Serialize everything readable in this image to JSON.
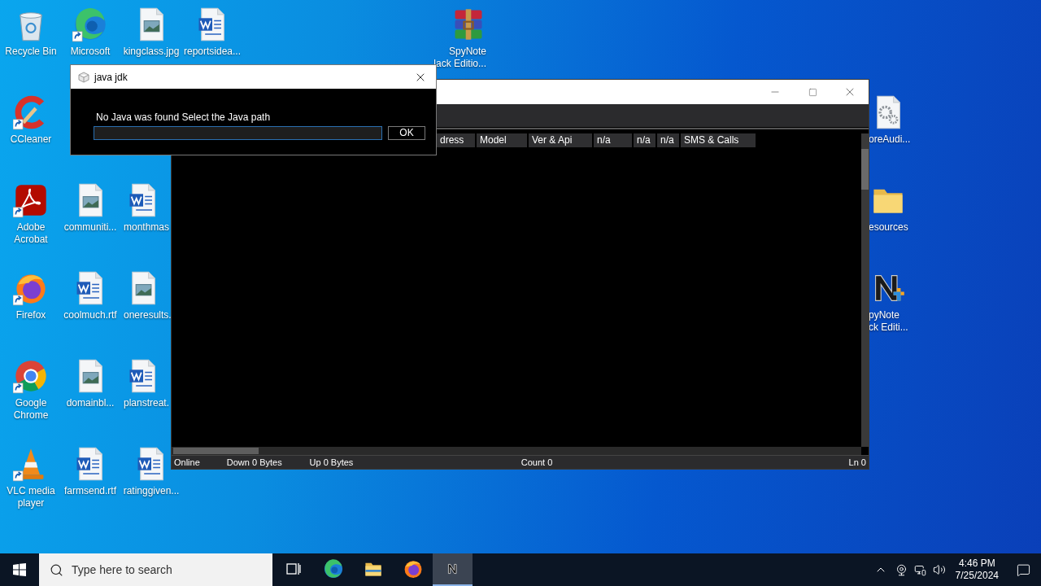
{
  "desktop_icons": [
    {
      "kind": "recycle_bin",
      "lines": [
        "Recycle Bin"
      ],
      "shortcut": false
    },
    {
      "kind": "edge",
      "lines": [
        "Microsoft"
      ],
      "shortcut": true
    },
    {
      "kind": "image_file",
      "lines": [
        "kingclass.jpg"
      ],
      "shortcut": false
    },
    {
      "kind": "word_file",
      "lines": [
        "reportsidea..."
      ],
      "shortcut": false
    },
    {
      "kind": "winrar",
      "lines": [
        "SpyNote",
        "lack Editio..."
      ],
      "shortcut": false
    },
    {
      "kind": "ccleaner",
      "lines": [
        "CCleaner"
      ],
      "shortcut": true
    },
    {
      "kind": "settings_file",
      "lines": [
        "oreAudi..."
      ],
      "shortcut": false
    },
    {
      "kind": "acrobat",
      "lines": [
        "Adobe",
        "Acrobat"
      ],
      "shortcut": true
    },
    {
      "kind": "image_file",
      "lines": [
        "communiti..."
      ],
      "shortcut": false
    },
    {
      "kind": "word_file",
      "lines": [
        "monthmas"
      ],
      "shortcut": false
    },
    {
      "kind": "folder",
      "lines": [
        "esources"
      ],
      "shortcut": false
    },
    {
      "kind": "firefox",
      "lines": [
        "Firefox"
      ],
      "shortcut": true
    },
    {
      "kind": "word_file",
      "lines": [
        "coolmuch.rtf"
      ],
      "shortcut": false
    },
    {
      "kind": "image_file",
      "lines": [
        "oneresults."
      ],
      "shortcut": false
    },
    {
      "kind": "spynote",
      "lines": [
        "pyNote",
        "ck Editi..."
      ],
      "shortcut": false
    },
    {
      "kind": "chrome",
      "lines": [
        "Google",
        "Chrome"
      ],
      "shortcut": true
    },
    {
      "kind": "image_file",
      "lines": [
        "domainbl..."
      ],
      "shortcut": false
    },
    {
      "kind": "word_file",
      "lines": [
        "planstreat."
      ],
      "shortcut": false
    },
    {
      "kind": "vlc",
      "lines": [
        "VLC media",
        "player"
      ],
      "shortcut": true
    },
    {
      "kind": "word_file",
      "lines": [
        "farmsend.rtf"
      ],
      "shortcut": false
    },
    {
      "kind": "word_file",
      "lines": [
        "ratinggiven..."
      ],
      "shortcut": false
    }
  ],
  "main_window": {
    "columns": [
      "dress",
      "Model",
      "Ver & Api",
      "n/a",
      "n/a",
      "n/a",
      "SMS & Calls"
    ],
    "status_bar": [
      "Online",
      "Down 0 Bytes",
      "Up 0 Bytes",
      "Count 0",
      "Ln 0"
    ]
  },
  "dialog": {
    "title": "java jdk",
    "message": "No Java was found Select the Java path",
    "button": "OK"
  },
  "taskbar": {
    "search_placeholder": "Type here to search",
    "apps": [
      {
        "kind": "task_view",
        "selected": false
      },
      {
        "kind": "edge",
        "selected": false
      },
      {
        "kind": "explorer",
        "selected": false
      },
      {
        "kind": "firefox",
        "selected": false
      },
      {
        "kind": "spynote",
        "selected": true
      }
    ],
    "time": "4:46 PM",
    "date": "7/25/2024"
  }
}
